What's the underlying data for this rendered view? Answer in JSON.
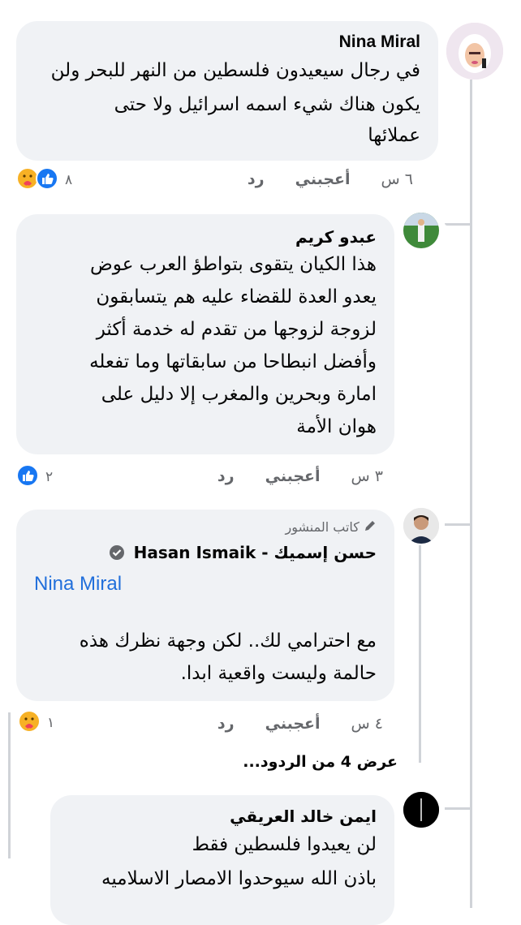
{
  "comments": [
    {
      "author": "Nina Miral",
      "text_lines": [
        "في رجال سيعيدون فلسطين من النهر للبحر ولن",
        "يكون هناك شيء اسمه اسرائيل ولا حتى",
        "عملائها"
      ],
      "time": "٦ س",
      "like_label": "أعجبني",
      "reply_label": "رد",
      "reaction_count": "٨"
    },
    {
      "author": "عبدو كريم",
      "text_lines": [
        "هذا الكيان يتقوى بتواطؤ العرب عوض",
        "يعدو العدة للقضاء عليه هم يتسابقون",
        "لزوجة لزوجها من تقدم له خدمة أكثر",
        "وأفضل انبطاحا من سابقاتها وما تفعله",
        "امارة وبحرين والمغرب إلا دليل على",
        "هوان الأمة"
      ],
      "time": "٣ س",
      "like_label": "أعجبني",
      "reply_label": "رد",
      "reaction_count": "٢"
    },
    {
      "author_badge": "كاتب المنشور",
      "author": "حسن إسميك - Hasan Ismaik",
      "mention": "Nina Miral",
      "text_lines": [
        "مع احترامي لك.. لكن وجهة نظرك هذه",
        "حالمة وليست واقعية ابدا."
      ],
      "time": "٤ س",
      "like_label": "أعجبني",
      "reply_label": "رد",
      "reaction_count": "١"
    },
    {
      "author": "ايمن خالد العريقي",
      "text_lines": [
        "لن يعيدوا فلسطين فقط",
        "باذن الله سيوحدوا الامصار الاسلاميه"
      ]
    }
  ],
  "view_replies": "عرض 4 من الردود...",
  "colors": {
    "bubble": "#f0f2f5",
    "link": "#216fdb",
    "meta": "#65676b",
    "like_blue": "#1877f2",
    "care_yellow": "#f7b125"
  },
  "icons": [
    "care-reaction-icon",
    "like-reaction-icon",
    "pencil-icon",
    "verified-badge-icon"
  ]
}
